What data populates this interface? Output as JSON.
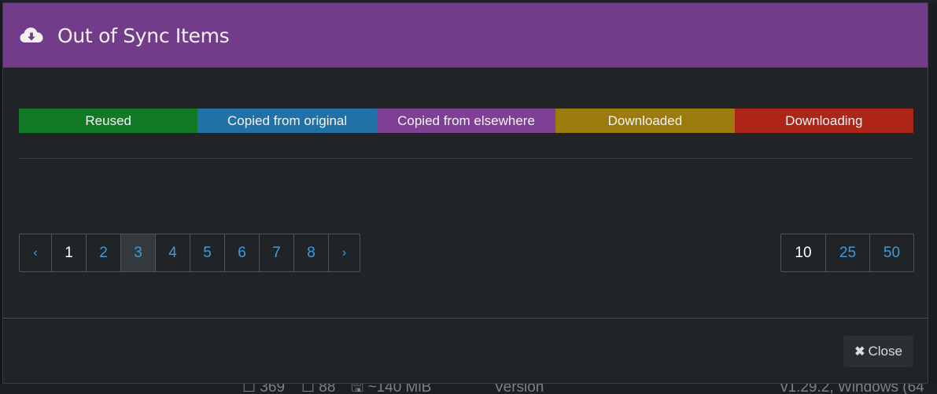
{
  "modal": {
    "title": "Out of Sync Items",
    "header_icon": "cloud-download-icon",
    "header_color": "#733c8a"
  },
  "legend": [
    {
      "label": "Reused",
      "color": "#127a27"
    },
    {
      "label": "Copied from original",
      "color": "#2170a6"
    },
    {
      "label": "Copied from elsewhere",
      "color": "#7e3f95"
    },
    {
      "label": "Downloaded",
      "color": "#9b7b0c"
    },
    {
      "label": "Downloading",
      "color": "#ad2419"
    }
  ],
  "pagination": {
    "prev": "‹",
    "next": "›",
    "pages": [
      "1",
      "2",
      "3",
      "4",
      "5",
      "6",
      "7",
      "8"
    ],
    "current": "1",
    "hovered": "3"
  },
  "page_sizes": {
    "options": [
      "10",
      "25",
      "50"
    ],
    "selected": "10"
  },
  "footer": {
    "close_label": "Close",
    "close_icon": "close-icon"
  },
  "background": {
    "stats": [
      "☐ 369",
      "☐ 88",
      "🖫 ~140 MiB"
    ],
    "version_label": "Version",
    "version_value": "v1.29.2, Windows (64"
  },
  "colors": {
    "link": "#3d9bdc",
    "panel": "#212426"
  }
}
